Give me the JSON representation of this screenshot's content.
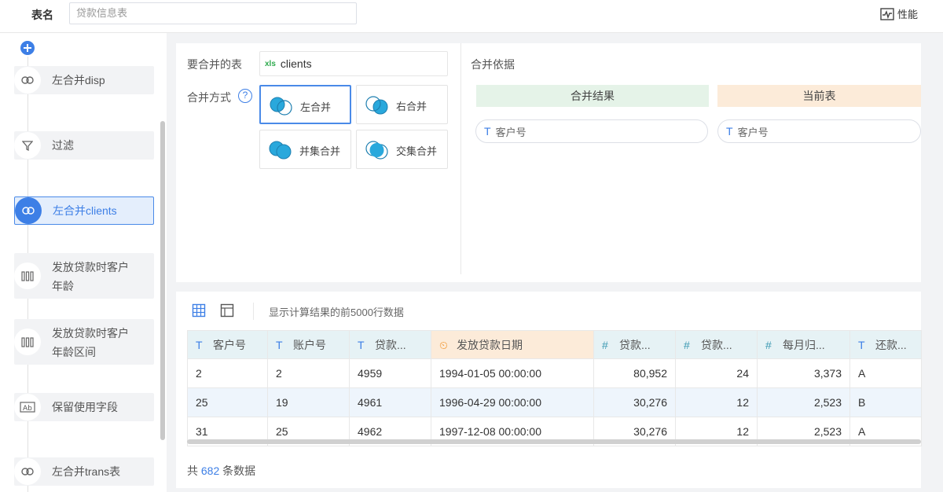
{
  "topbar": {
    "label": "表名",
    "table_name": "贷款信息表",
    "perf_label": "性能"
  },
  "sidebar": {
    "steps": [
      {
        "label": "左合并disp",
        "icon": "link-icon"
      },
      {
        "label": "过滤",
        "icon": "filter-icon"
      },
      {
        "label": "左合并clients",
        "icon": "link-icon",
        "active": true
      },
      {
        "label": "发放贷款时客户",
        "label2": "年龄",
        "icon": "column-icon"
      },
      {
        "label": "发放贷款时客户",
        "label2": "年龄区间",
        "icon": "column-icon"
      },
      {
        "label": "保留使用字段",
        "icon": "ab-icon"
      },
      {
        "label": "左合并trans表",
        "icon": "link-icon"
      }
    ]
  },
  "config": {
    "merge_table_label": "要合并的表",
    "merge_table_value": "clients",
    "merge_table_icon": "xls",
    "merge_mode_label": "合并方式",
    "help_glyph": "?",
    "modes": [
      {
        "label": "左合并",
        "selected": true
      },
      {
        "label": "右合并"
      },
      {
        "label": "并集合并"
      },
      {
        "label": "交集合并"
      }
    ],
    "basis_label": "合并依据",
    "result_header": "合并结果",
    "current_header": "当前表",
    "result_field": "客户号",
    "current_field": "客户号",
    "type_glyph": "T"
  },
  "result": {
    "hint": "显示计算结果的前5000行数据",
    "columns": [
      {
        "glyph": "T",
        "label": "客户号"
      },
      {
        "glyph": "T",
        "label": "账户号"
      },
      {
        "glyph": "T",
        "label": "贷款..."
      },
      {
        "glyph": "⏲",
        "label": "发放贷款日期"
      },
      {
        "glyph": "#",
        "label": "贷款..."
      },
      {
        "glyph": "#",
        "label": "贷款..."
      },
      {
        "glyph": "#",
        "label": "每月归..."
      },
      {
        "glyph": "T",
        "label": "还款..."
      }
    ],
    "rows": [
      [
        "2",
        "2",
        "4959",
        "1994-01-05 00:00:00",
        "80,952",
        "24",
        "3,373",
        "A"
      ],
      [
        "25",
        "19",
        "4961",
        "1996-04-29 00:00:00",
        "30,276",
        "12",
        "2,523",
        "B"
      ],
      [
        "31",
        "25",
        "4962",
        "1997-12-08 00:00:00",
        "30,276",
        "12",
        "2,523",
        "A"
      ]
    ],
    "total_prefix": "共",
    "total_count": "682",
    "total_suffix": "条数据"
  },
  "colors": {
    "accent": "#3d7fe6",
    "merge_fill": "#29a8dc",
    "result_header_bg": "#e5f3e8",
    "current_header_bg": "#fcebd9"
  }
}
